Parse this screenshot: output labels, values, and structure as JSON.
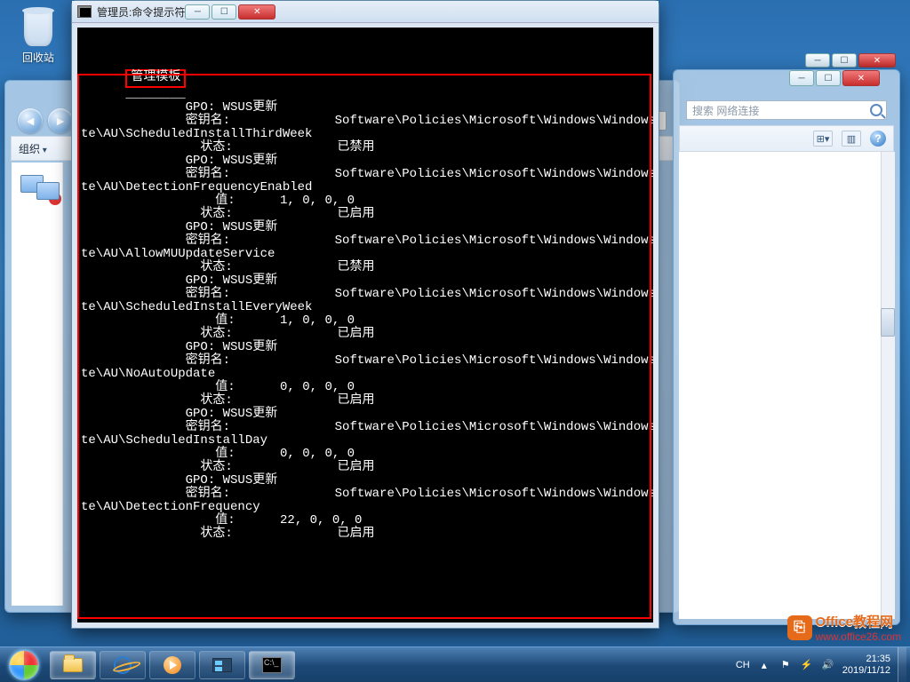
{
  "desktop": {
    "recycle_bin": "回收站"
  },
  "cmd": {
    "title_prefix": "管理员: ",
    "title": "命令提示符",
    "header_label": "管理模板",
    "underline": "________",
    "labels": {
      "gpo": "GPO:",
      "key": "密钥名:",
      "value": "值:",
      "state": "状态:"
    },
    "policy_name": "WSUS更新",
    "key_prefix": "Software\\Policies\\Microsoft\\Windows\\WindowsUpda",
    "entries": [
      {
        "key_suffix": "te\\AU\\ScheduledInstallThirdWeek",
        "value": null,
        "state": "已禁用"
      },
      {
        "key_suffix": "te\\AU\\DetectionFrequencyEnabled",
        "value": "1, 0, 0, 0",
        "state": "已启用"
      },
      {
        "key_suffix": "te\\AU\\AllowMUUpdateService",
        "value": null,
        "state": "已禁用"
      },
      {
        "key_suffix": "te\\AU\\ScheduledInstallEveryWeek",
        "value": "1, 0, 0, 0",
        "state": "已启用"
      },
      {
        "key_suffix": "te\\AU\\NoAutoUpdate",
        "value": "0, 0, 0, 0",
        "state": "已启用"
      },
      {
        "key_suffix": "te\\AU\\ScheduledInstallDay",
        "value": "0, 0, 0, 0",
        "state": "已启用"
      },
      {
        "key_suffix": "te\\AU\\DetectionFrequency",
        "value": "22, 0, 0, 0",
        "state": "已启用"
      }
    ]
  },
  "explorer_back": {
    "organize": "组织"
  },
  "explorer_front": {
    "search_placeholder": "搜索 网络连接",
    "view_icon": "⊞",
    "help": "?"
  },
  "taskbar": {
    "ime": "CH",
    "time": "21:35",
    "date": "2019/11/12"
  },
  "watermark": {
    "brand": "Office教程网",
    "url": "www.office26.com"
  },
  "colors": {
    "highlight": "#ff0000",
    "console_fg": "#ffffff",
    "console_bg": "#000000"
  }
}
